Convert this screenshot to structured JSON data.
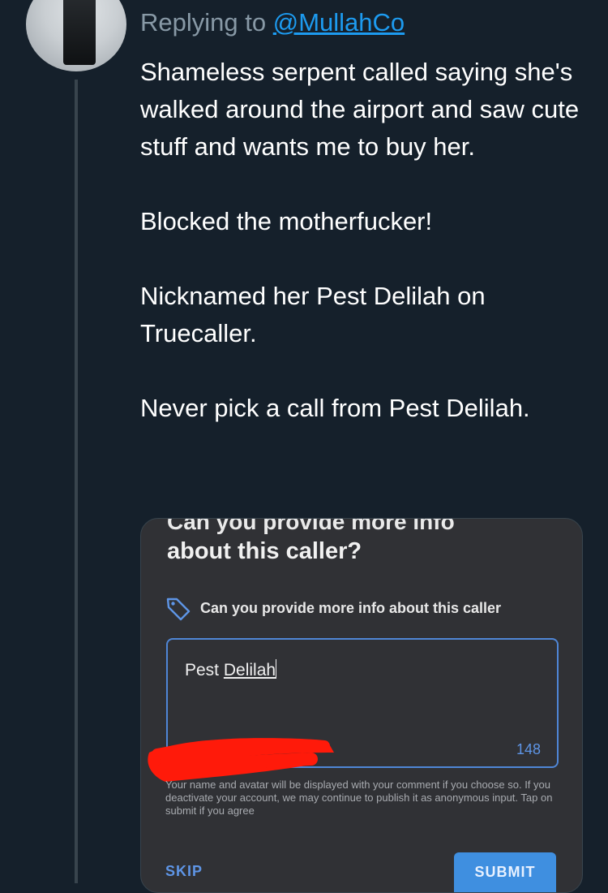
{
  "reply": {
    "prefix": "Replying to",
    "handle": "@MullahCo"
  },
  "tweet": {
    "paragraphs": [
      "Shameless serpent called saying she's walked around the airport and saw cute stuff and wants me to buy her.",
      "Blocked the motherfucker!",
      "Nicknamed her Pest Delilah on Truecaller.",
      "Never pick a call from Pest Delilah."
    ]
  },
  "screenshot": {
    "cut_title": "Can you provide more info",
    "title": "about this caller?",
    "prompt": "Can you provide more info about this caller",
    "field_word1": "Pest",
    "field_word2": "Delilah",
    "counter": "148",
    "disclaimer": "Your name and avatar will be displayed with your comment if you choose so. If you deactivate your account, we may continue to publish it as anonymous input. Tap on submit if you agree",
    "skip_label": "SKIP",
    "submit_label": "SUBMIT",
    "tag_icon": "tag-icon"
  },
  "colors": {
    "background": "#15202b",
    "link": "#1d9bf0",
    "dialog": "#303135",
    "accent": "#4f86d6",
    "redaction": "#ff1a0a"
  }
}
